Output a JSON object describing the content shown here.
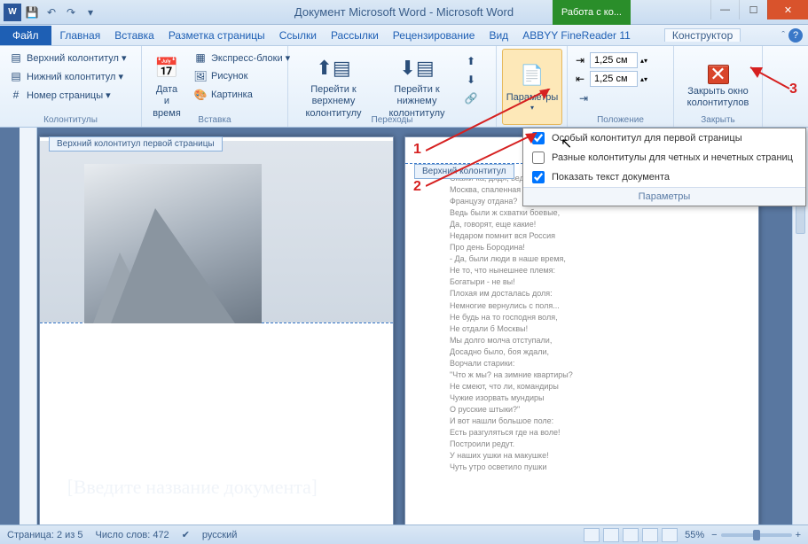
{
  "title": "Документ Microsoft Word - Microsoft Word",
  "context_tab": "Работа с ко...",
  "qat": {
    "save": "save",
    "undo": "undo",
    "redo": "redo"
  },
  "menu": {
    "file": "Файл",
    "items": [
      "Главная",
      "Вставка",
      "Разметка страницы",
      "Ссылки",
      "Рассылки",
      "Рецензирование",
      "Вид",
      "ABBYY FineReader 11"
    ],
    "constructor": "Конструктор"
  },
  "ribbon": {
    "group_headers": "Колонтитулы",
    "header_btn": "Верхний колонтитул ▾",
    "footer_btn": "Нижний колонтитул ▾",
    "pagenum_btn": "Номер страницы ▾",
    "group_insert": "Вставка",
    "date_btn": "Дата и время",
    "express_btn": "Экспресс-блоки ▾",
    "picture_btn": "Рисунок",
    "clipart_btn": "Картинка",
    "group_nav": "Переходы",
    "goto_header": "Перейти к верхнему колонтитулу",
    "goto_footer": "Перейти к нижнему колонтитулу",
    "group_options": "Параметры",
    "options_btn": "Параметры",
    "group_position": "Положение",
    "top_val": "1,25 см",
    "bottom_val": "1,25 см",
    "group_close": "Закрыть",
    "close_btn": "Закрыть окно колонтитулов"
  },
  "dropdown": {
    "opt1": "Особый колонтитул для первой страницы",
    "opt2": "Разные колонтитулы для четных и нечетных страниц",
    "opt3": "Показать текст документа",
    "footer": "Параметры",
    "chk1": true,
    "chk2": false,
    "chk3": true
  },
  "page1": {
    "header_tab": "Верхний колонтитул первой страницы",
    "cover_title": "[Введите название документа]"
  },
  "page2": {
    "header_tab": "Верхний колонтитул",
    "poem": "Скажи-ка, дядя, ведь не даром\nМосква, спаленная пожаром,\nФранцузу отдана?\nВедь были ж схватки боевые,\nДа, говорят, еще какие!\nНедаром помнит вся Россия\nПро день Бородина!\n- Да, были люди в наше время,\nНе то, что нынешнее племя:\nБогатыри - не вы!\nПлохая им досталась доля:\nНемногие вернулись с поля...\nНе будь на то господня воля,\nНе отдали б Москвы!\nМы долго молча отступали,\nДосадно было, боя ждали,\nВорчали старики:\n\"Что ж мы? на зимние квартиры?\nНе смеют, что ли, командиры\nЧужие изорвать мундиры\nО русские штыки?\"\nИ вот нашли большое поле:\nЕсть разгуляться где на воле!\nПостроили редут.\nУ наших ушки на макушке!\nЧуть утро осветило пушки"
  },
  "status": {
    "page": "Страница: 2 из 5",
    "words": "Число слов: 472",
    "lang": "русский",
    "zoom": "55%",
    "zoom_minus": "−",
    "zoom_plus": "+"
  },
  "annot": {
    "n1": "1",
    "n2": "2",
    "n3": "3"
  }
}
